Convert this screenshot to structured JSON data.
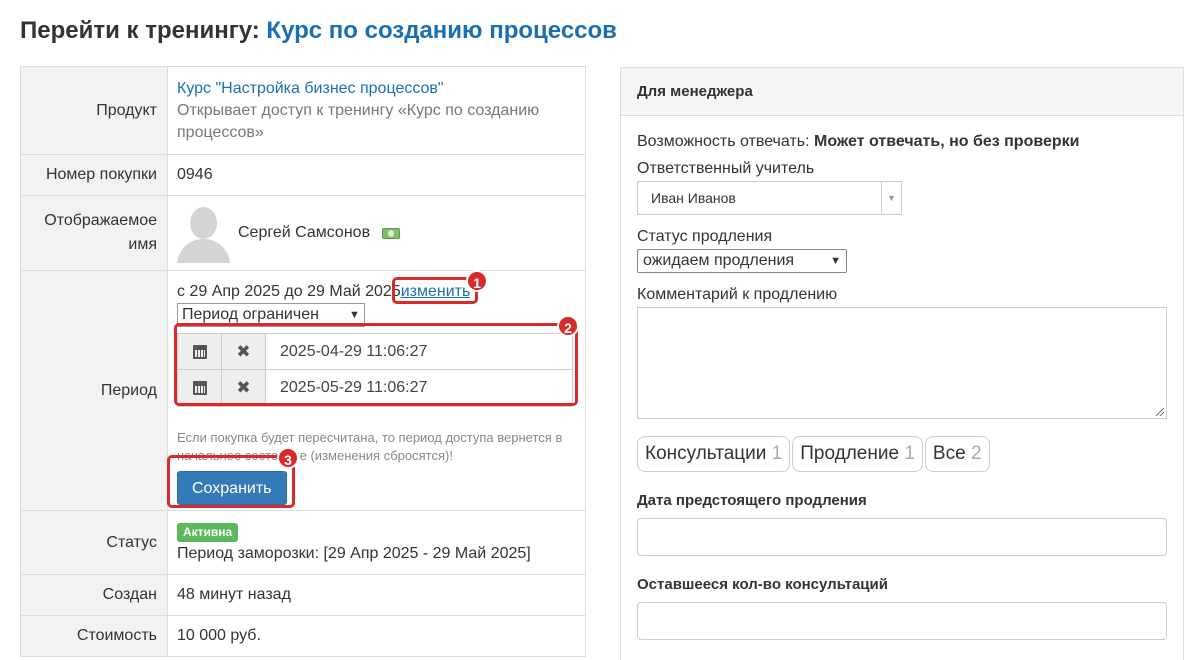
{
  "header": {
    "prefix": "Перейти к тренингу:",
    "training_link": "Курс по созданию процессов"
  },
  "info": {
    "product": {
      "label": "Продукт",
      "link": "Курс \"Настройка бизнес процессов\"",
      "description": "Открывает доступ к тренингу «Курс по созданию процессов»"
    },
    "purchase": {
      "label": "Номер покупки",
      "value": "0946"
    },
    "display_name": {
      "label": "Отображаемое имя",
      "value": "Сергей Самсонов"
    },
    "period": {
      "label": "Период",
      "text": "с 29 Апр 2025 до 29 Май 2025",
      "change_link": "изменить",
      "select_value": "Период ограничен",
      "start": "2025-04-29 11:06:27",
      "end": "2025-05-29 11:06:27",
      "note": "Если покупка будет пересчитана, то период доступа вернется в начальное состояние (изменения сбросятся)!",
      "save_label": "Сохранить"
    },
    "status": {
      "label": "Статус",
      "badge": "Активна",
      "freeze": "Период заморозки: [29 Апр 2025 - 29 Май 2025]"
    },
    "created": {
      "label": "Создан",
      "value": "48 минут назад"
    },
    "cost": {
      "label": "Стоимость",
      "value": "10 000 руб."
    }
  },
  "callouts": [
    "1",
    "2",
    "3"
  ],
  "manager": {
    "title": "Для менеджера",
    "answer_label": "Возможность отвечать:",
    "answer_value": "Может отвечать, но без проверки",
    "teacher_label": "Ответственный учитель",
    "teacher_value": "Иван Иванов",
    "renewal_status_label": "Статус продления",
    "renewal_status_value": "ожидаем продления",
    "comment_label": "Комментарий к продлению",
    "tabs": [
      {
        "label": "Консультации",
        "count": "1"
      },
      {
        "label": "Продление",
        "count": "1"
      },
      {
        "label": "Все",
        "count": "2"
      }
    ],
    "next_renewal_label": "Дата предстоящего продления",
    "remaining_label": "Оставшееся кол-во консультаций"
  },
  "colors": {
    "link": "#1a6fb3",
    "callout": "#d9292b",
    "primary_button": "#337ab7",
    "active_badge": "#5cb85c"
  }
}
